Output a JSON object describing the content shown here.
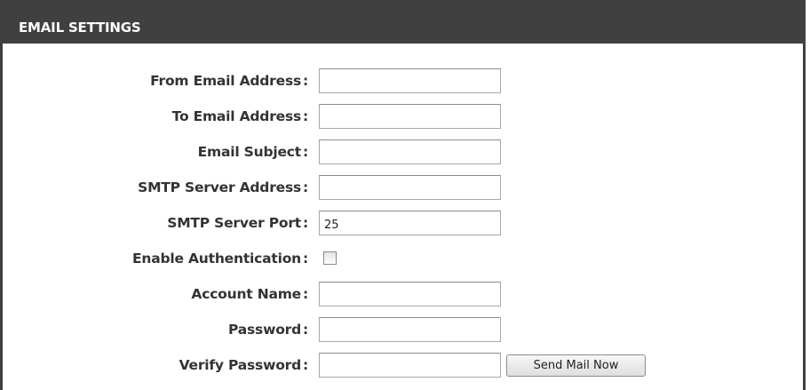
{
  "section": {
    "title": "EMAIL SETTINGS"
  },
  "form": {
    "colon": ":",
    "fields": [
      {
        "label": "From Email Address",
        "value": ""
      },
      {
        "label": "To Email Address",
        "value": ""
      },
      {
        "label": "Email Subject",
        "value": ""
      },
      {
        "label": "SMTP Server Address",
        "value": ""
      },
      {
        "label": "SMTP Server Port",
        "value": "25"
      },
      {
        "label": "Enable Authentication",
        "checked": false
      },
      {
        "label": "Account Name",
        "value": ""
      },
      {
        "label": "Password",
        "value": ""
      },
      {
        "label": "Verify Password",
        "value": ""
      }
    ],
    "send_button_label": "Send Mail Now"
  }
}
